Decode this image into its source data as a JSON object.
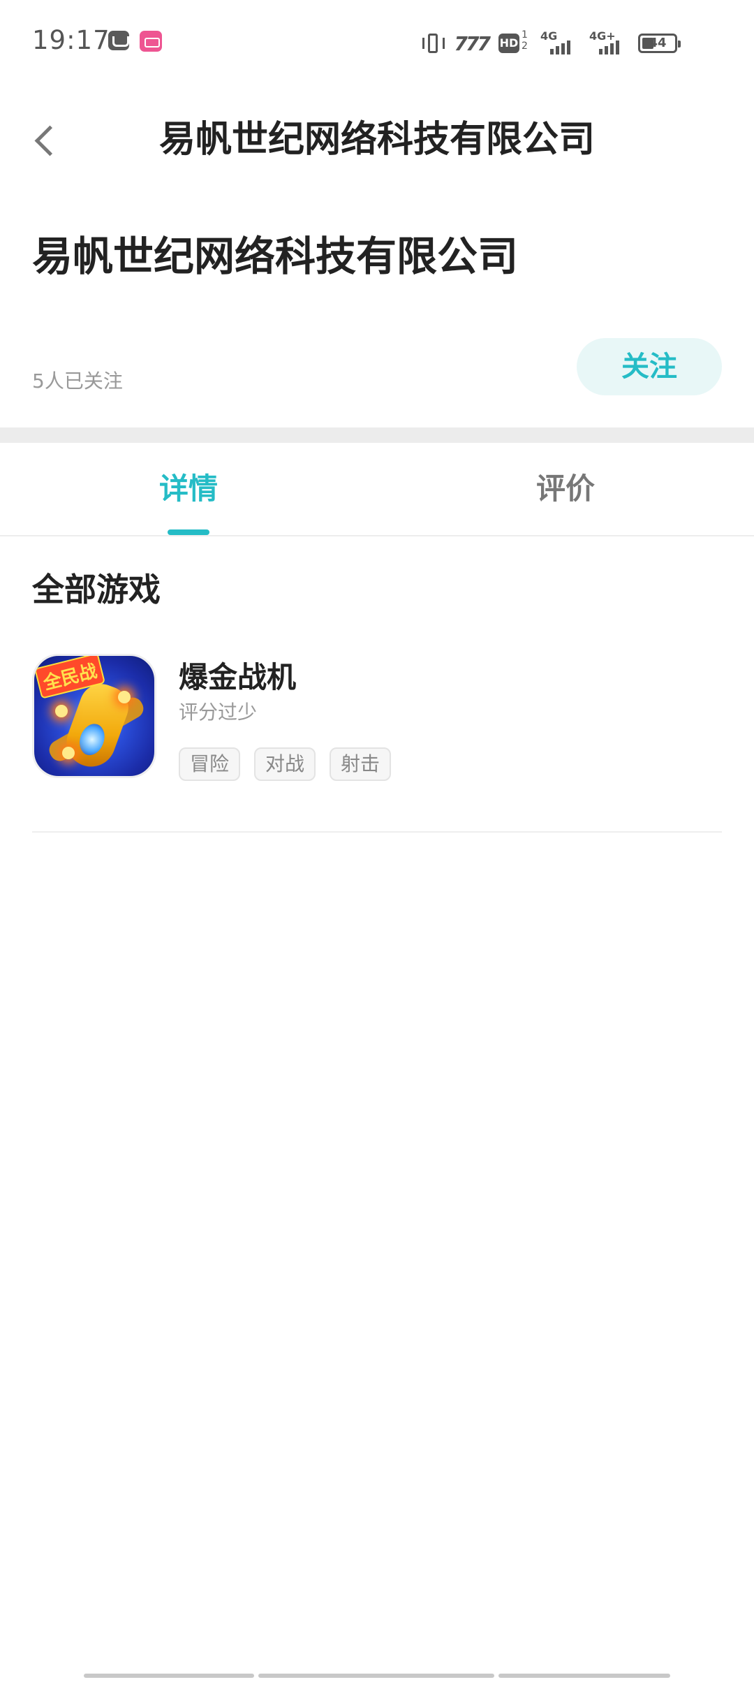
{
  "status_bar": {
    "time": "19:17",
    "app_icons": [
      "message-app-icon",
      "bilibili-app-icon"
    ],
    "network_speed": "777",
    "hd_label": "HD",
    "hd_superscript": "1 2",
    "signal1_label": "4G",
    "signal2_label": "4G+",
    "battery": "44"
  },
  "header": {
    "back_icon": "back-arrow-icon",
    "title": "易帆世纪网络科技有限公司"
  },
  "company": {
    "name": "易帆世纪网络科技有限公司",
    "followers": "5人已关注",
    "follow_label": "关注"
  },
  "tabs": [
    {
      "label": "详情",
      "active": true
    },
    {
      "label": "评价",
      "active": false
    }
  ],
  "games_section": {
    "title": "全部游戏",
    "games": [
      {
        "name": "爆金战机",
        "icon_banner": "全民战",
        "rating_text": "评分过少",
        "tags": [
          "冒险",
          "对战",
          "射击"
        ]
      }
    ]
  },
  "colors": {
    "accent": "#25bcc6",
    "follow_bg": "#e8f7f7",
    "band_gray": "#ececec"
  }
}
